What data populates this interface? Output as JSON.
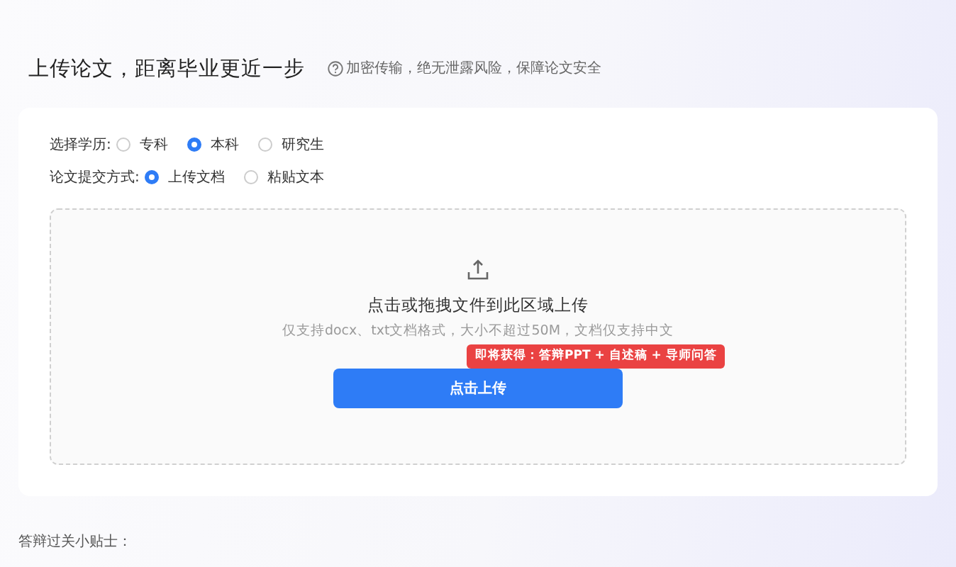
{
  "header": {
    "title": "上传论文，距离毕业更近一步",
    "note": "加密传输，绝无泄露风险，保障论文安全"
  },
  "form": [
    {
      "label": "选择学历:",
      "options": [
        {
          "label": "专科",
          "selected": false
        },
        {
          "label": "本科",
          "selected": true
        },
        {
          "label": "研究生",
          "selected": false
        }
      ]
    },
    {
      "label": "论文提交方式:",
      "options": [
        {
          "label": "上传文档",
          "selected": true
        },
        {
          "label": "粘贴文本",
          "selected": false
        }
      ]
    }
  ],
  "upload": {
    "title": "点击或拖拽文件到此区域上传",
    "hint": "仅支持docx、txt文档格式，大小不超过50M，文档仅支持中文",
    "button": "点击上传",
    "badge": "即将获得：答辩PPT + 自述稿 + 导师问答"
  },
  "footer": {
    "title": "答辩过关小贴士："
  }
}
